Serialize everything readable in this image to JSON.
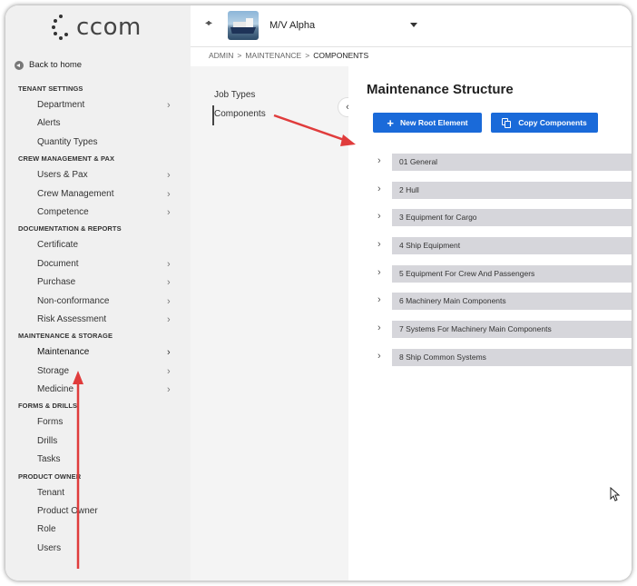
{
  "app": {
    "logo_text": "ccom"
  },
  "sidebar": {
    "back_home": "Back to home",
    "sections": [
      {
        "title": "TENANT SETTINGS",
        "items": [
          {
            "label": "Department",
            "chevron": true
          },
          {
            "label": "Alerts",
            "chevron": false
          },
          {
            "label": "Quantity Types",
            "chevron": false
          }
        ]
      },
      {
        "title": "CREW MANAGEMENT & PAX",
        "items": [
          {
            "label": "Users & Pax",
            "chevron": true
          },
          {
            "label": "Crew Management",
            "chevron": true
          },
          {
            "label": "Competence",
            "chevron": true
          }
        ]
      },
      {
        "title": "DOCUMENTATION & REPORTS",
        "items": [
          {
            "label": "Certificate",
            "chevron": false
          },
          {
            "label": "Document",
            "chevron": true
          },
          {
            "label": "Purchase",
            "chevron": true
          },
          {
            "label": "Non-conformance",
            "chevron": true
          },
          {
            "label": "Risk Assessment",
            "chevron": true
          }
        ]
      },
      {
        "title": "MAINTENANCE & STORAGE",
        "items": [
          {
            "label": "Maintenance",
            "chevron": true,
            "active": true
          },
          {
            "label": "Storage",
            "chevron": true
          },
          {
            "label": "Medicine",
            "chevron": true
          }
        ]
      },
      {
        "title": "FORMS & DRILLS",
        "items": [
          {
            "label": "Forms",
            "chevron": false
          },
          {
            "label": "Drills",
            "chevron": false
          },
          {
            "label": "Tasks",
            "chevron": false
          }
        ]
      },
      {
        "title": "PRODUCT OWNER",
        "items": [
          {
            "label": "Tenant",
            "chevron": false
          },
          {
            "label": "Product Owner",
            "chevron": false
          },
          {
            "label": "Role",
            "chevron": false
          },
          {
            "label": "Users",
            "chevron": false
          }
        ]
      }
    ]
  },
  "topbar": {
    "vessel_name": "M/V Alpha"
  },
  "breadcrumb": {
    "items": [
      "ADMIN",
      "MAINTENANCE",
      "COMPONENTS"
    ],
    "separator": ">"
  },
  "subnav": {
    "items": [
      "Job Types",
      "Components"
    ],
    "active": "Components"
  },
  "main": {
    "title": "Maintenance Structure",
    "new_root_label": "New Root Element",
    "copy_label": "Copy Components",
    "tree": [
      "01 General",
      "2 Hull",
      "3 Equipment for Cargo",
      "4 Ship Equipment",
      "5 Equipment For Crew And Passengers",
      "6 Machinery Main Components",
      "7 Systems For Machinery Main Components",
      "8 Ship Common Systems"
    ]
  },
  "colors": {
    "accent": "#1a6ad9",
    "annotation_arrow": "#e03c3c",
    "sidebar_bg": "#f0f0f0",
    "tree_row_bg": "#d6d6db"
  }
}
